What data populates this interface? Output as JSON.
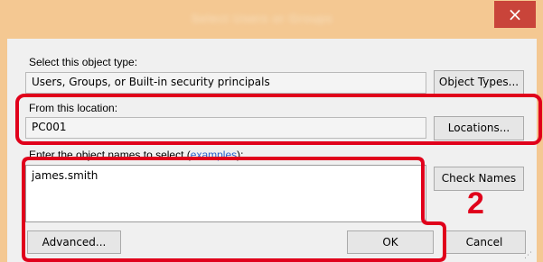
{
  "dialog": {
    "title": "Select Users or Groups",
    "close_glyph": "×",
    "object_type_label": "Select this object type:",
    "object_type_value": "Users, Groups, or Built-in security principals",
    "object_types_button": "Object Types...",
    "location_label": "From this location:",
    "location_value": "PC001",
    "locations_button": "Locations...",
    "enter_names_prefix": "Enter the object names to select (",
    "examples_link": "examples",
    "enter_names_suffix": "):",
    "names_value": "james.smith",
    "check_names_button": "Check Names",
    "advanced_button": "Advanced...",
    "ok_button": "OK",
    "cancel_button": "Cancel",
    "step_number": "2",
    "annotation_color": "#e0001b"
  }
}
